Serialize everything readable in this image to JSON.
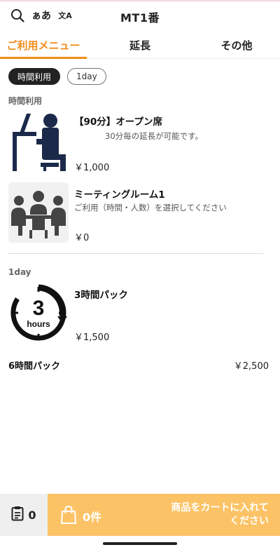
{
  "header": {
    "title": "MT1番",
    "font_size_label": "ぁあ",
    "language_label": "文A"
  },
  "tabs": [
    {
      "label": "ご利用メニュー"
    },
    {
      "label": "延長"
    },
    {
      "label": "その他"
    }
  ],
  "filters": [
    {
      "label": "時間利用"
    },
    {
      "label": "1day"
    }
  ],
  "sections": {
    "time": {
      "label": "時間利用",
      "items": [
        {
          "name": "【90分】オープン席",
          "description": "30分毎の延長が可能です。",
          "price": "￥1,000",
          "icon": "person-at-desk-icon"
        },
        {
          "name": "ミーティングルーム1",
          "description": "ご利用（時間・人数）を選択してください",
          "price": "￥0",
          "icon": "meeting-room-icon"
        }
      ]
    },
    "day": {
      "label": "1day",
      "items": [
        {
          "name": "3時間パック",
          "price": "￥1,500",
          "icon": "3-hours-icon",
          "icon_number": "3",
          "icon_unit": "hours"
        },
        {
          "name": "6時間パック",
          "price": "￥2,500"
        }
      ]
    }
  },
  "footer": {
    "order_count": "0",
    "cart_count": "0件",
    "cart_message": "商品をカートに入れてください"
  },
  "colors": {
    "accent": "#f08c1a",
    "cart_bg": "#fcc366",
    "icon_navy": "#1b2a4a"
  }
}
